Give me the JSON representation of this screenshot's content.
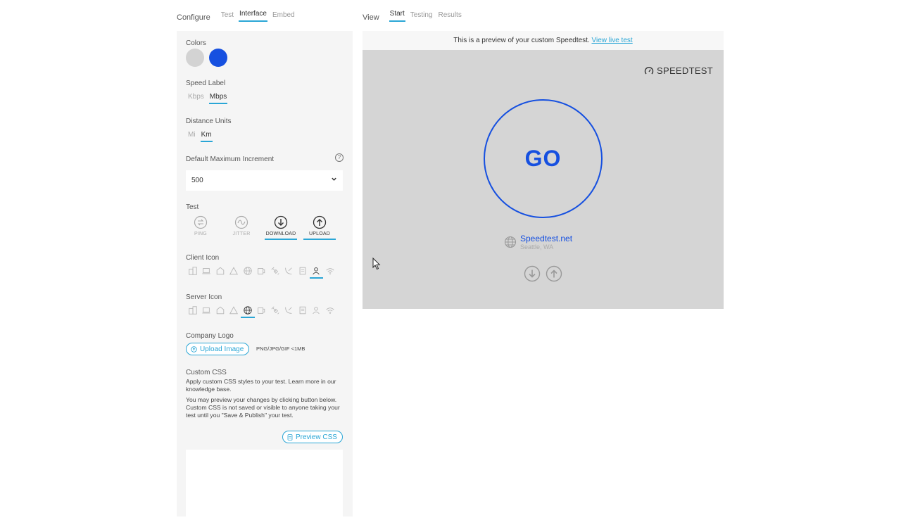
{
  "configure": {
    "heading": "Configure",
    "tabs": [
      {
        "label": "Test",
        "active": false
      },
      {
        "label": "Interface",
        "active": true
      },
      {
        "label": "Embed",
        "active": false
      }
    ]
  },
  "view": {
    "heading": "View",
    "tabs": [
      {
        "label": "Start",
        "active": true
      },
      {
        "label": "Testing",
        "active": false
      },
      {
        "label": "Results",
        "active": false
      }
    ]
  },
  "colors": {
    "label": "Colors",
    "swatches": [
      "#d3d3d3",
      "#1650e0"
    ]
  },
  "speed_label": {
    "label": "Speed Label",
    "options": [
      "Kbps",
      "Mbps"
    ],
    "selected": "Mbps"
  },
  "distance_units": {
    "label": "Distance Units",
    "options": [
      "Mi",
      "Km"
    ],
    "selected": "Km"
  },
  "max_increment": {
    "label": "Default Maximum Increment",
    "help_icon": "question-circle-icon",
    "value": "500"
  },
  "test": {
    "label": "Test",
    "items": [
      {
        "label": "PING",
        "icon": "ping-icon",
        "on": false
      },
      {
        "label": "JITTER",
        "icon": "jitter-icon",
        "on": false
      },
      {
        "label": "DOWNLOAD",
        "icon": "download-arrow-icon",
        "on": true
      },
      {
        "label": "UPLOAD",
        "icon": "upload-arrow-icon",
        "on": true
      }
    ]
  },
  "client_icon": {
    "label": "Client Icon",
    "icons": [
      "buildings-icon",
      "laptop-icon",
      "house-icon",
      "tent-icon",
      "globe-icon",
      "device-icon",
      "satellite-icon",
      "dish-icon",
      "document-icon",
      "person-icon",
      "wifi-icon"
    ],
    "selected_index": 9
  },
  "server_icon": {
    "label": "Server Icon",
    "icons": [
      "buildings-icon",
      "laptop-icon",
      "house-icon",
      "tent-icon",
      "globe-icon",
      "device-icon",
      "satellite-icon",
      "dish-icon",
      "document-icon",
      "person-icon",
      "wifi-icon"
    ],
    "selected_index": 4
  },
  "company_logo": {
    "label": "Company Logo",
    "button": "Upload Image",
    "hint": "PNG/JPG/GIF <1MB"
  },
  "custom_css": {
    "label": "Custom CSS",
    "para1": "Apply custom CSS styles to your test. Learn more in our knowledge base.",
    "para2": "You may preview your changes by clicking button below. Custom CSS is not saved or visible to anyone taking your test until you \"Save & Publish\" your test.",
    "button": "Preview CSS"
  },
  "preview": {
    "notice": "This is a preview of your custom Speedtest.",
    "link": "View live test",
    "brand": "SPEEDTEST",
    "go_label": "GO",
    "server_name": "Speedtest.net",
    "server_location": "Seattle, WA"
  }
}
